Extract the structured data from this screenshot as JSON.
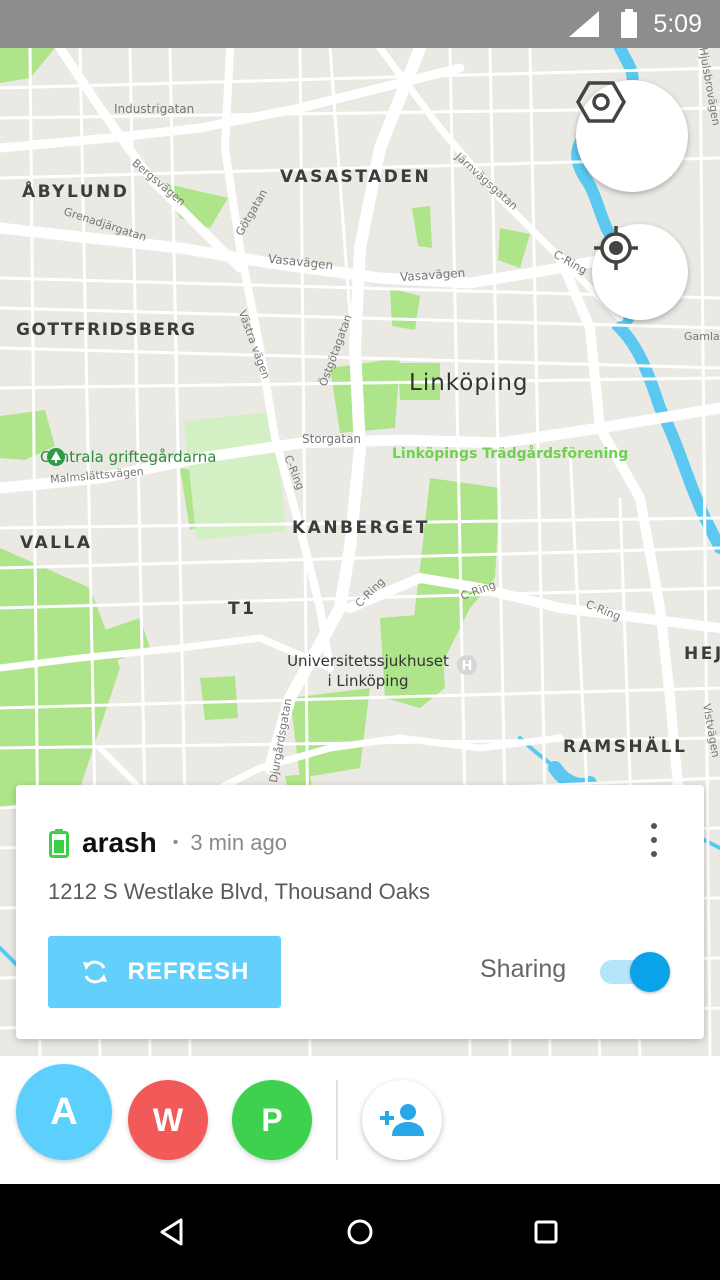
{
  "status_bar": {
    "time": "5:09",
    "icons": [
      "signal-icon",
      "battery-icon"
    ]
  },
  "map": {
    "city_label": "Linköping",
    "district_labels": [
      "ÅBYLUND",
      "VASASTADEN",
      "GOTTFRIDSBERG",
      "VALLA",
      "KANBERGET",
      "T1",
      "RAMSHÄLL",
      "HEJ"
    ],
    "street_labels": [
      "Industrigatan",
      "Bergsvägen",
      "Grenadjärgatan",
      "Götgatan",
      "Vasavägen",
      "Vasavägen",
      "Järnvägsgatan",
      "C-Ring",
      "Västra vägen",
      "Östgötagatan",
      "Storgatan",
      "Malmslättsvägen",
      "C-Ring",
      "C-Ring",
      "C-Ring",
      "C-Ring",
      "Djurgårdsgatan",
      "Gamla",
      "Vistvägen",
      "Hjulsbrovägen"
    ],
    "poi_cemetery": "Centrala griftegårdarna",
    "poi_park": "Linköpings Trädgårdsförening",
    "poi_hospital_line1": "Universitetssjukhuset",
    "poi_hospital_line2": "i Linköping",
    "colors": {
      "land": "#ebe9e3",
      "park": "#aee48a",
      "water": "#5ac8f0",
      "road": "#ffffff"
    },
    "buttons": [
      "hexagon-nut-icon",
      "my-location-icon"
    ]
  },
  "card": {
    "battery_color": "#3ecf4a",
    "username": "arash",
    "separator": "•",
    "time_ago": "3 min ago",
    "address": "1212 S Westlake Blvd, Thousand Oaks",
    "refresh_label": "REFRESH",
    "sharing_label": "Sharing",
    "sharing_enabled": true
  },
  "members": [
    {
      "initial": "A",
      "color": "#5dcffc",
      "selected": true
    },
    {
      "initial": "W",
      "color": "#f25a5a",
      "selected": false
    },
    {
      "initial": "P",
      "color": "#3ed14e",
      "selected": false
    }
  ],
  "add_member_icon": "person-add-icon",
  "nav_bar": [
    "back-icon",
    "home-icon",
    "recents-icon"
  ]
}
